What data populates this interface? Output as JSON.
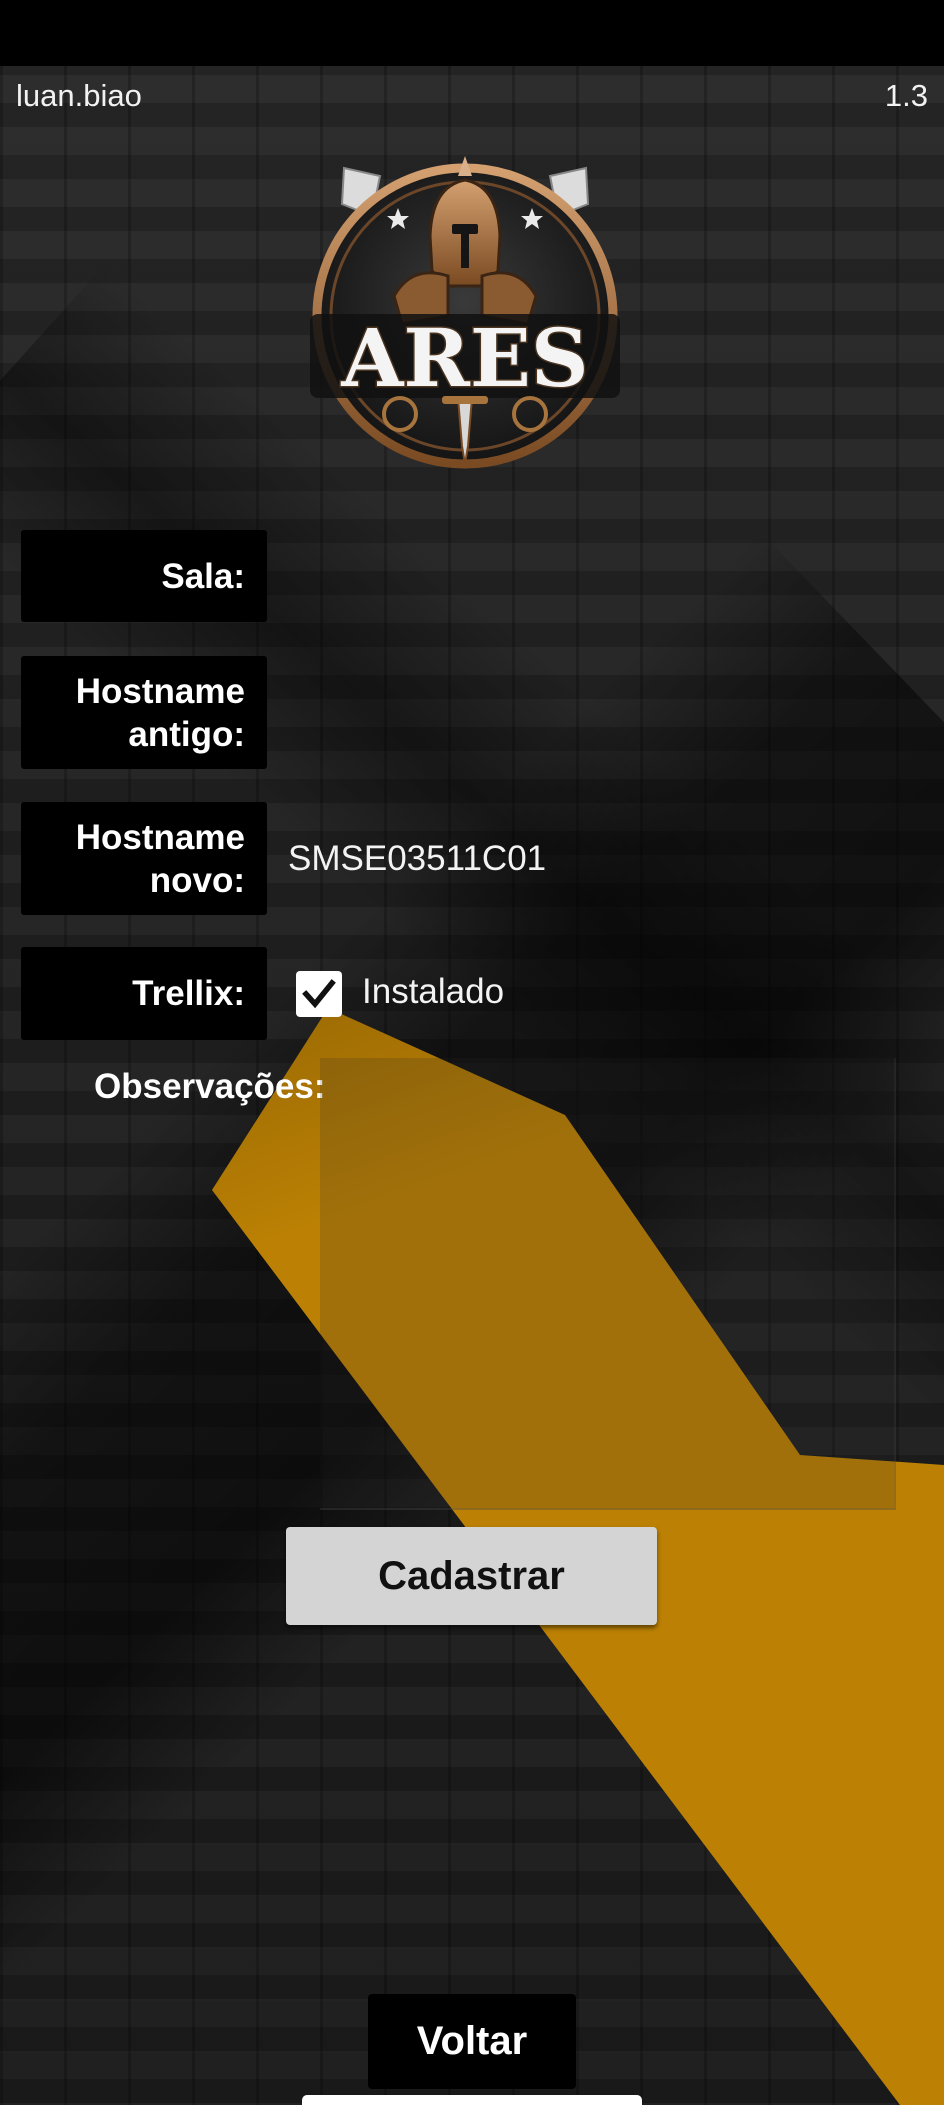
{
  "header": {
    "username": "luan.biao",
    "version": "1.3"
  },
  "logo": {
    "text": "ARES",
    "icon": "spartan-warrior-shield-logo"
  },
  "form": {
    "sala": {
      "label": "Sala:",
      "value": ""
    },
    "hostname_antigo": {
      "label_line1": "Hostname",
      "label_line2": "antigo:",
      "value": ""
    },
    "hostname_novo": {
      "label_line1": "Hostname",
      "label_line2": "novo:",
      "value": "SMSE03511C01"
    },
    "trellix": {
      "label": "Trellix:",
      "checkbox_label": "Instalado",
      "checked": true
    },
    "observacoes": {
      "label": "Observações:",
      "value": ""
    }
  },
  "buttons": {
    "submit_label": "Cadastrar",
    "back_label": "Voltar"
  },
  "colors": {
    "accent_yellow": "#c08404",
    "label_bg": "#000000",
    "button_bg": "#d4d4d4"
  }
}
